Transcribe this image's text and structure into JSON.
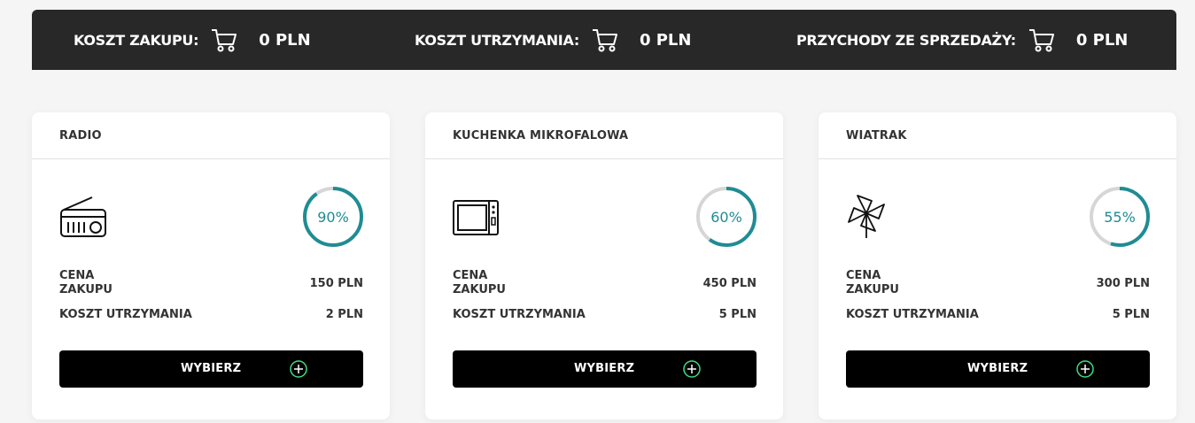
{
  "summary": {
    "purchase_cost": {
      "label": "KOSZT ZAKUPU:",
      "value": "0 PLN",
      "icon": "cart-icon"
    },
    "upkeep_cost": {
      "label": "KOSZT UTRZYMANIA:",
      "value": "0 PLN",
      "icon": "cart-icon"
    },
    "sales_revenue": {
      "label": "PRZYCHODY ZE SPRZEDAŻY:",
      "value": "0 PLN",
      "icon": "cart-icon"
    }
  },
  "products": [
    {
      "title": "RADIO",
      "icon": "radio-icon",
      "percent_text": "90%",
      "percent": 90,
      "price_label": "CENA ZAKUPU",
      "price": "150 PLN",
      "upkeep_label": "KOSZT UTRZYMANIA",
      "upkeep": "2 PLN",
      "button_label": "WYBIERZ"
    },
    {
      "title": "KUCHENKA MIKROFALOWA",
      "icon": "microwave-icon",
      "percent_text": "60%",
      "percent": 60,
      "price_label": "CENA ZAKUPU",
      "price": "450 PLN",
      "upkeep_label": "KOSZT UTRZYMANIA",
      "upkeep": "5 PLN",
      "button_label": "WYBIERZ"
    },
    {
      "title": "WIATRAK",
      "icon": "pinwheel-icon",
      "percent_text": "55%",
      "percent": 55,
      "price_label": "CENA ZAKUPU",
      "price": "300 PLN",
      "upkeep_label": "KOSZT UTRZYMANIA",
      "upkeep": "5 PLN",
      "button_label": "WYBIERZ"
    }
  ],
  "colors": {
    "gauge_fill": "#1f8c93",
    "gauge_track": "#d6d6d6",
    "topbar_bg": "#282828",
    "button_bg": "#000000",
    "button_icon": "#3ddc84"
  }
}
